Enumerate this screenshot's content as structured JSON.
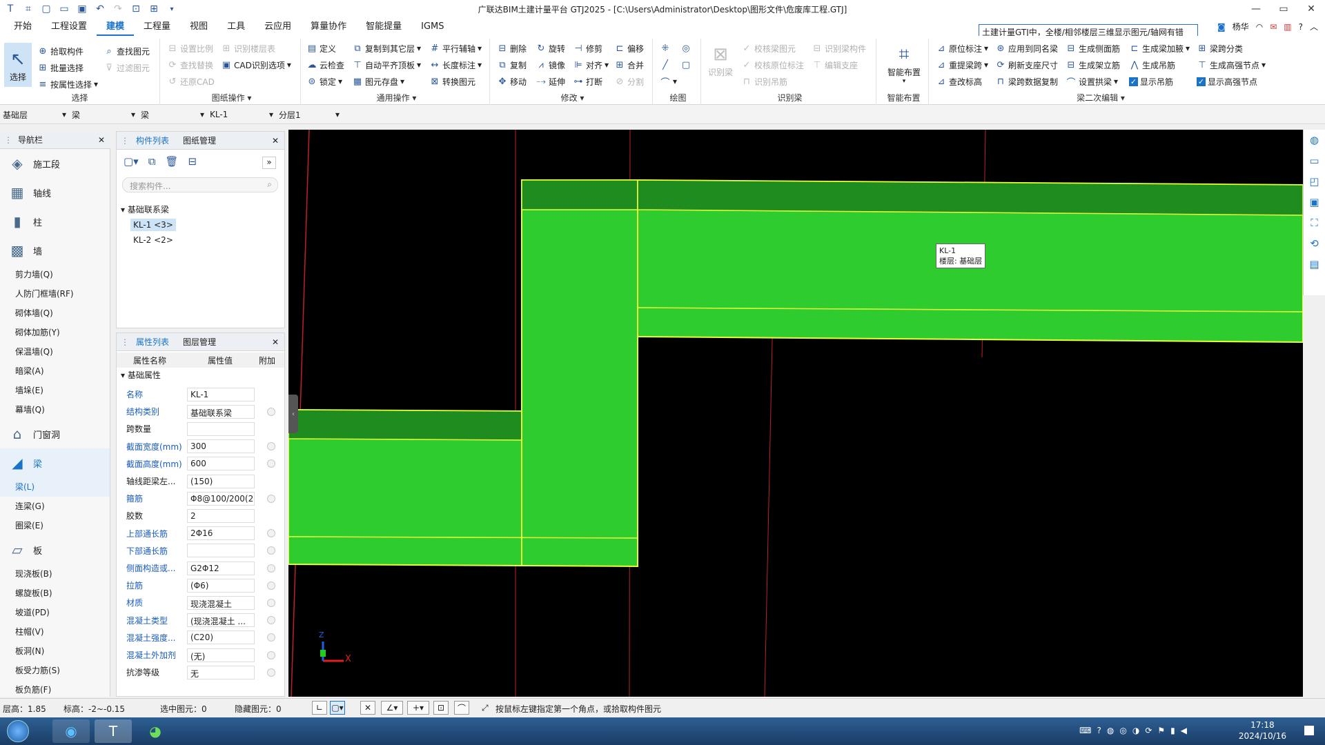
{
  "window": {
    "title": "广联达BIM土建计量平台 GTJ2025 - [C:\\Users\\Administrator\\Desktop\\图形文件\\危废库工程.GTJ]",
    "min": "—",
    "max": "▭",
    "close": "✕"
  },
  "menus": [
    "开始",
    "工程设置",
    "建模",
    "工程量",
    "视图",
    "工具",
    "云应用",
    "算量协作",
    "智能提量",
    "IGMS"
  ],
  "active_menu": "建模",
  "top_search": "土建计量GTJ中，全楼/相邻楼层三维显示图元/轴网有错",
  "user": "杨华",
  "ribbon": {
    "select": {
      "title": "选择",
      "big": "选择",
      "items": [
        "拾取构件",
        "批量选择",
        "按属性选择",
        "查找图元",
        "过滤图元"
      ]
    },
    "drawing_ops": {
      "title": "图纸操作",
      "items": [
        "设置比例",
        "识别楼层表",
        "查找替换",
        "CAD识别选项",
        "还原CAD"
      ]
    },
    "general_ops": {
      "title": "通用操作",
      "items": [
        "定义",
        "复制到其它层",
        "平行辅轴",
        "云检查",
        "自动平齐顶板",
        "长度标注",
        "锁定",
        "图元存盘",
        "转换图元"
      ]
    },
    "modify": {
      "title": "修改",
      "items": [
        "删除",
        "旋转",
        "修剪",
        "偏移",
        "复制",
        "镜像",
        "对齐",
        "合并",
        "移动",
        "延伸",
        "打断",
        "分割"
      ]
    },
    "draw": {
      "title": "绘图"
    },
    "recognize": {
      "title": "识别梁",
      "big": "识别梁",
      "items": [
        "校核梁图元",
        "识别梁构件",
        "校核原位标注",
        "编辑支座",
        "识别吊筋"
      ]
    },
    "smart": {
      "title": "智能布置",
      "big": "智能布置"
    },
    "beam_edit": {
      "title": "梁二次编辑",
      "items": [
        "原位标注",
        "应用到同名梁",
        "生成侧面筋",
        "生成梁加腋",
        "梁跨分类",
        "重提梁跨",
        "刷新支座尺寸",
        "生成架立筋",
        "生成吊筋",
        "生成高强节点",
        "查改标高",
        "梁跨数据复制",
        "设置拱梁",
        "显示吊筋",
        "显示高强节点"
      ]
    }
  },
  "selectors": [
    "基础层",
    "梁",
    "梁",
    "KL-1",
    "分层1"
  ],
  "nav": {
    "title": "导航栏",
    "categories": [
      {
        "label": "施工段",
        "icon": "layers-icon"
      },
      {
        "label": "轴线",
        "icon": "grid-icon"
      },
      {
        "label": "柱",
        "icon": "column-icon"
      },
      {
        "label": "墙",
        "icon": "wall-icon"
      }
    ],
    "wall_items": [
      "剪力墙(Q)",
      "人防门框墙(RF)",
      "砌体墙(Q)",
      "砌体加筋(Y)",
      "保温墙(Q)",
      "暗梁(A)",
      "墙垛(E)",
      "幕墙(Q)"
    ],
    "door": "门窗洞",
    "beam": "梁",
    "beam_items": [
      "梁(L)",
      "连梁(G)",
      "圈梁(E)"
    ],
    "slab": "板",
    "slab_items": [
      "现浇板(B)",
      "螺旋板(B)",
      "坡道(PD)",
      "柱帽(V)",
      "板洞(N)",
      "板受力筋(S)",
      "板负筋(F)"
    ]
  },
  "component_list": {
    "tabs": [
      "构件列表",
      "图纸管理"
    ],
    "search_placeholder": "搜索构件...",
    "group": "基础联系梁",
    "items": [
      "KL-1 <3>",
      "KL-2 <2>"
    ]
  },
  "properties": {
    "tabs": [
      "属性列表",
      "图层管理"
    ],
    "headers": [
      "属性名称",
      "属性值",
      "附加"
    ],
    "group": "基础属性",
    "rows": [
      {
        "name": "名称",
        "value": "KL-1",
        "blue": true
      },
      {
        "name": "结构类别",
        "value": "基础联系梁",
        "blue": true
      },
      {
        "name": "跨数量",
        "value": "",
        "blue": false
      },
      {
        "name": "截面宽度(mm)",
        "value": "300",
        "blue": true
      },
      {
        "name": "截面高度(mm)",
        "value": "600",
        "blue": true
      },
      {
        "name": "轴线距梁左...",
        "value": "(150)",
        "blue": false
      },
      {
        "name": "箍筋",
        "value": "Φ8@100/200(2)",
        "blue": true
      },
      {
        "name": "胶数",
        "value": "2",
        "blue": false
      },
      {
        "name": "上部通长筋",
        "value": "2Φ16",
        "blue": true
      },
      {
        "name": "下部通长筋",
        "value": "",
        "blue": true
      },
      {
        "name": "侧面构造或...",
        "value": "G2Φ12",
        "blue": true
      },
      {
        "name": "拉筋",
        "value": "(Φ6)",
        "blue": true
      },
      {
        "name": "材质",
        "value": "现浇混凝土",
        "blue": true
      },
      {
        "name": "混凝土类型",
        "value": "(现浇混凝土 ...",
        "blue": true
      },
      {
        "name": "混凝土强度...",
        "value": "(C20)",
        "blue": true
      },
      {
        "name": "混凝土外加剂",
        "value": "(无)",
        "blue": true
      },
      {
        "name": "抗渗等级",
        "value": "无",
        "blue": false
      }
    ]
  },
  "canvas": {
    "tooltip_name": "KL-1",
    "tooltip_floor": "楼层: 基础层",
    "axis_x": "X",
    "axis_z": "Z"
  },
  "status": {
    "floor_height": "层高：1.85",
    "elevation": "标高：-2~-0.15",
    "selected": "选中图元：0",
    "hidden": "隐藏图元：0",
    "hint": "按鼠标左键指定第一个角点，或拾取构件图元"
  },
  "taskbar": {
    "time": "17:18",
    "date": "2024/10/16"
  },
  "colors": {
    "beam_fill": "#2ecc2e",
    "beam_dark": "#1e8c1e",
    "beam_edge": "#e8ff3a",
    "accent": "#1a73c8"
  }
}
